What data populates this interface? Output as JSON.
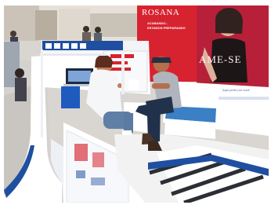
{
  "signage": {
    "brand": "ROSANA",
    "promo_line1": "ACABANDO...",
    "promo_line2": "ESTAMOS PREPARANDO",
    "slogan": "AME-SE"
  },
  "kiosk": {
    "bench_text": "Aqui perto por você"
  },
  "colors": {
    "banner_red": "#d7232f",
    "kiosk_blue": "#1f4fa0",
    "bench_blue": "#3b7fc4",
    "floor": "#cfcfcf"
  }
}
